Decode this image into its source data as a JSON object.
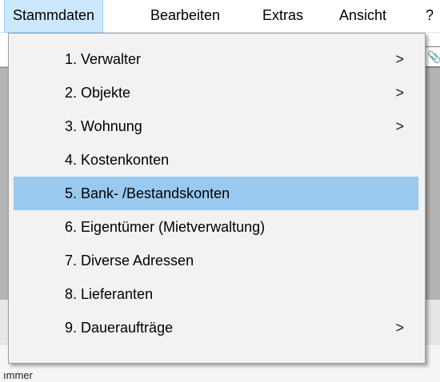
{
  "menubar": {
    "items": [
      {
        "label": "Stammdaten",
        "active": true
      },
      {
        "label": "Bearbeiten"
      },
      {
        "label": "Extras"
      },
      {
        "label": "Ansicht"
      },
      {
        "label": "?"
      }
    ]
  },
  "dropdown": {
    "items": [
      {
        "label": "1. Verwalter",
        "submenu": true,
        "arrow": ">"
      },
      {
        "label": "2. Objekte",
        "submenu": true,
        "arrow": ">"
      },
      {
        "label": "3. Wohnung",
        "submenu": true,
        "arrow": ">"
      },
      {
        "label": "4. Kostenkonten",
        "submenu": false
      },
      {
        "label": "5. Bank- /Bestandskonten",
        "submenu": false,
        "highlighted": true
      },
      {
        "label": "6. Eigentümer (Mietverwaltung)",
        "submenu": false
      },
      {
        "label": "7. Diverse Adressen",
        "submenu": false
      },
      {
        "label": "8. Lieferanten",
        "submenu": false
      },
      {
        "label": "9. Daueraufträge",
        "submenu": true,
        "arrow": ">"
      }
    ]
  },
  "background": {
    "footer_text": "ımmer"
  },
  "colors": {
    "highlight": "#99c9ef",
    "menu_active": "#cce8ff",
    "menu_bg": "#f2f2f2"
  }
}
